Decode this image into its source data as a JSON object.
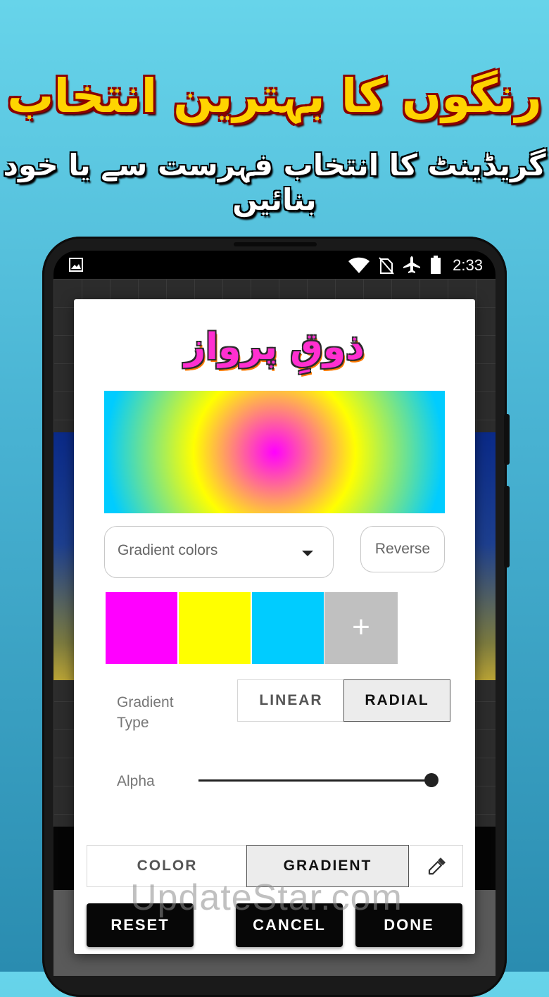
{
  "promo": {
    "title": "رنگوں کا بہترین انتخاب",
    "subtitle": "گریڈینٹ کا انتخاب فہرست سے یا خود بنائیں"
  },
  "status_bar": {
    "time": "2:33",
    "icons": [
      "image-icon",
      "wifi-icon",
      "no-sim-icon",
      "airplane-icon",
      "battery-icon"
    ]
  },
  "dialog": {
    "logo_text": "ذوقِ پرواز",
    "gradient_dropdown": {
      "selected": "Gradient colors"
    },
    "reverse_label": "Reverse",
    "swatches": [
      "#ff00ff",
      "#ffff00",
      "#00ccff"
    ],
    "add_swatch_label": "+",
    "gradient_type_label": "Gradient Type",
    "gradient_type_options": [
      "LINEAR",
      "RADIAL"
    ],
    "gradient_type_selected": "RADIAL",
    "alpha_label": "Alpha",
    "alpha_value": 1.0,
    "mode_tabs": [
      "COLOR",
      "GRADIENT"
    ],
    "mode_selected": "GRADIENT",
    "buttons": {
      "reset": "RESET",
      "cancel": "CANCEL",
      "done": "DONE"
    }
  },
  "watermark": "UpdateStar.com",
  "colors": {
    "promo_title": "#ffd400",
    "promo_title_outline": "#8b0000",
    "logo": "#ff2fd0",
    "button_bg": "#070707"
  }
}
